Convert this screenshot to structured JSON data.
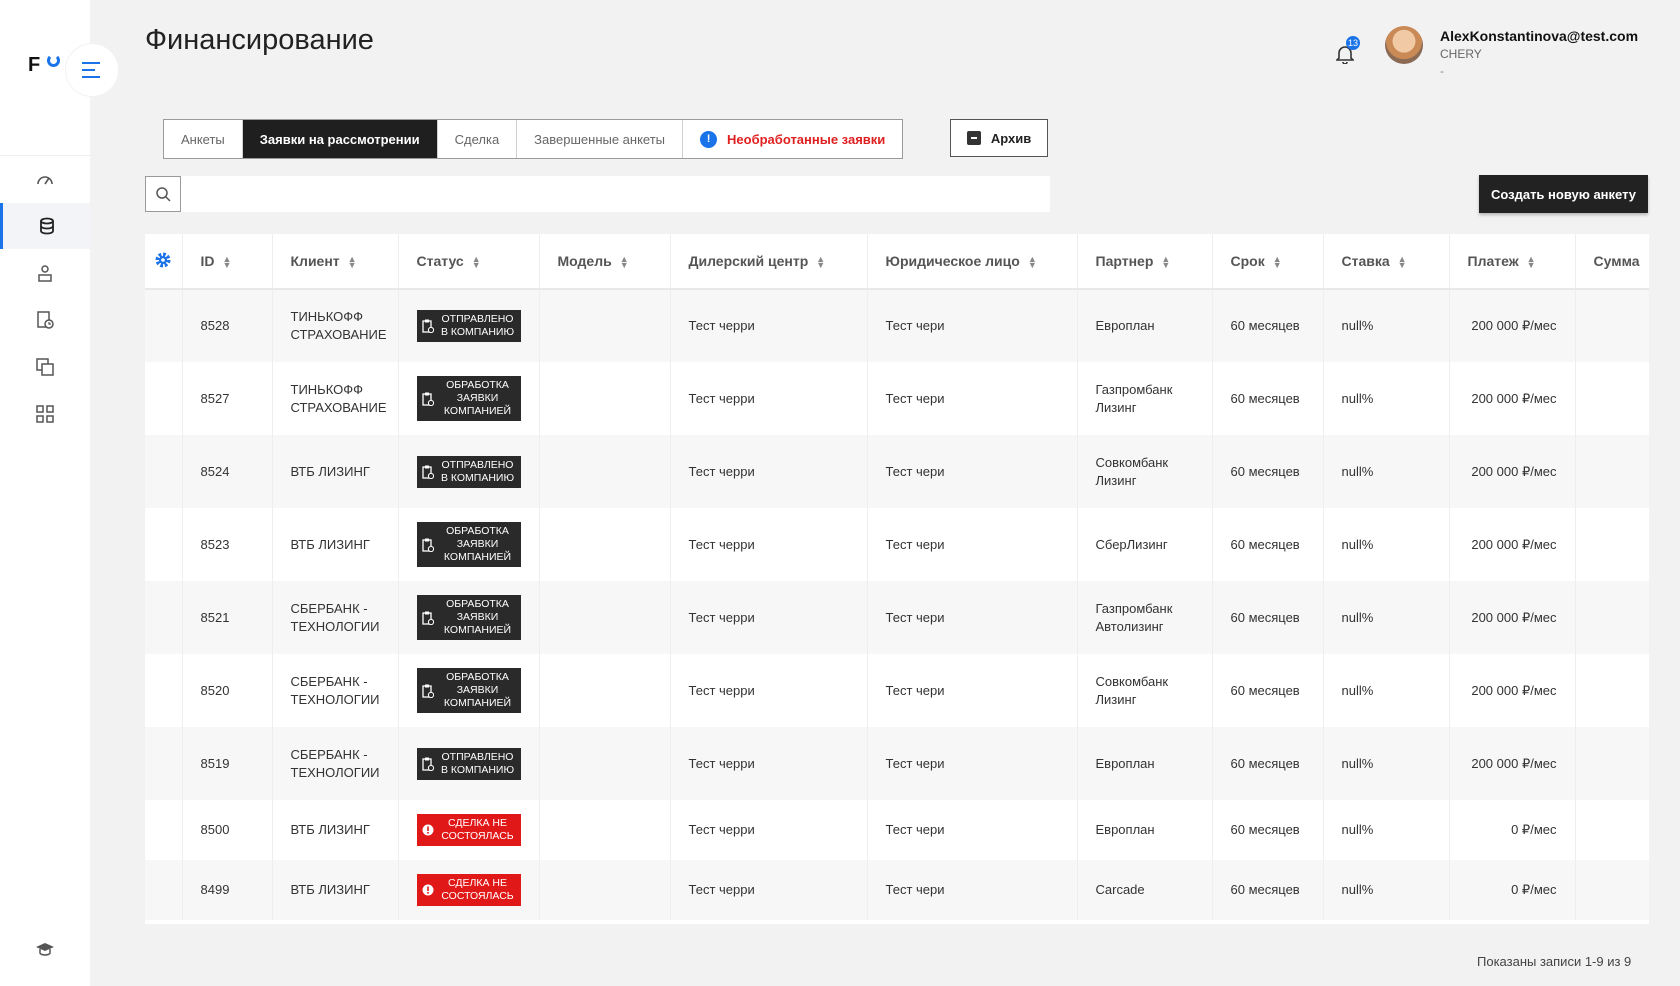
{
  "page": {
    "title": "Финансирование"
  },
  "brand": {
    "logo_text": "F",
    "accent": "#1a73e8"
  },
  "user": {
    "email": "AlexKonstantinova@test.com",
    "company": "CHERY",
    "extra": "-",
    "notifications": "13"
  },
  "sidebar": {
    "items": [
      {
        "icon": "speedometer-icon"
      },
      {
        "icon": "coins-icon"
      },
      {
        "icon": "user-hierarchy-icon"
      },
      {
        "icon": "document-clock-icon"
      },
      {
        "icon": "layers-icon"
      },
      {
        "icon": "grid-icon"
      }
    ],
    "bottom_icon": "graduation-cap-icon",
    "active_index": 1
  },
  "tabs": [
    {
      "label": "Анкеты"
    },
    {
      "label": "Заявки на рассмотрении"
    },
    {
      "label": "Сделка"
    },
    {
      "label": "Завершенные анкеты"
    },
    {
      "label": "Необработанные заявки"
    }
  ],
  "tabs_alert_mark": "!",
  "archive_label": "Архив",
  "search": {
    "placeholder": "",
    "value": ""
  },
  "create_label": "Создать новую анкету",
  "table": {
    "columns": [
      "ID",
      "Клиент",
      "Статус",
      "Модель",
      "Дилерский центр",
      "Юридическое лицо",
      "Партнер",
      "Срок",
      "Ставка",
      "Платеж",
      "Сумма"
    ],
    "rows": [
      {
        "id": "8528",
        "client": "ТИНЬКОФФ СТРАХОВАНИЕ",
        "status": "ОТПРАВЛЕНО В КОМПАНИЮ",
        "status_type": "dark",
        "model": "",
        "dealer": "Тест черри",
        "legal": "Тест чери",
        "partner": "Европлан",
        "term": "60 месяцев",
        "rate": "null%",
        "payment": "200 000 ₽/мес",
        "sum": ""
      },
      {
        "id": "8527",
        "client": "ТИНЬКОФФ СТРАХОВАНИЕ",
        "status": "ОБРАБОТКА ЗАЯВКИ КОМПАНИЕЙ",
        "status_type": "dark",
        "model": "",
        "dealer": "Тест черри",
        "legal": "Тест чери",
        "partner": "Газпромбанк Лизинг",
        "term": "60 месяцев",
        "rate": "null%",
        "payment": "200 000 ₽/мес",
        "sum": ""
      },
      {
        "id": "8524",
        "client": "ВТБ ЛИЗИНГ",
        "status": "ОТПРАВЛЕНО В КОМПАНИЮ",
        "status_type": "dark",
        "model": "",
        "dealer": "Тест черри",
        "legal": "Тест чери",
        "partner": "Совкомбанк Лизинг",
        "term": "60 месяцев",
        "rate": "null%",
        "payment": "200 000 ₽/мес",
        "sum": ""
      },
      {
        "id": "8523",
        "client": "ВТБ ЛИЗИНГ",
        "status": "ОБРАБОТКА ЗАЯВКИ КОМПАНИЕЙ",
        "status_type": "dark",
        "model": "",
        "dealer": "Тест черри",
        "legal": "Тест чери",
        "partner": "СберЛизинг",
        "term": "60 месяцев",
        "rate": "null%",
        "payment": "200 000 ₽/мес",
        "sum": ""
      },
      {
        "id": "8521",
        "client": "СБЕРБАНК - ТЕХНОЛОГИИ",
        "status": "ОБРАБОТКА ЗАЯВКИ КОМПАНИЕЙ",
        "status_type": "dark",
        "model": "",
        "dealer": "Тест черри",
        "legal": "Тест чери",
        "partner": "Газпромбанк Автолизинг",
        "term": "60 месяцев",
        "rate": "null%",
        "payment": "200 000 ₽/мес",
        "sum": ""
      },
      {
        "id": "8520",
        "client": "СБЕРБАНК - ТЕХНОЛОГИИ",
        "status": "ОБРАБОТКА ЗАЯВКИ КОМПАНИЕЙ",
        "status_type": "dark",
        "model": "",
        "dealer": "Тест черри",
        "legal": "Тест чери",
        "partner": "Совкомбанк Лизинг",
        "term": "60 месяцев",
        "rate": "null%",
        "payment": "200 000 ₽/мес",
        "sum": ""
      },
      {
        "id": "8519",
        "client": "СБЕРБАНК - ТЕХНОЛОГИИ",
        "status": "ОТПРАВЛЕНО В КОМПАНИЮ",
        "status_type": "dark",
        "model": "",
        "dealer": "Тест черри",
        "legal": "Тест чери",
        "partner": "Европлан",
        "term": "60 месяцев",
        "rate": "null%",
        "payment": "200 000 ₽/мес",
        "sum": ""
      },
      {
        "id": "8500",
        "client": "ВТБ ЛИЗИНГ",
        "status": "СДЕЛКА НЕ СОСТОЯЛАСЬ",
        "status_type": "red",
        "model": "",
        "dealer": "Тест черри",
        "legal": "Тест чери",
        "partner": "Европлан",
        "term": "60 месяцев",
        "rate": "null%",
        "payment": "0 ₽/мес",
        "sum": ""
      },
      {
        "id": "8499",
        "client": "ВТБ ЛИЗИНГ",
        "status": "СДЕЛКА НЕ СОСТОЯЛАСЬ",
        "status_type": "red",
        "model": "",
        "dealer": "Тест черри",
        "legal": "Тест чери",
        "partner": "Carcade",
        "term": "60 месяцев",
        "rate": "null%",
        "payment": "0 ₽/мес",
        "sum": ""
      }
    ]
  },
  "footer": {
    "records_text": "Показаны записи 1-9 из 9"
  }
}
